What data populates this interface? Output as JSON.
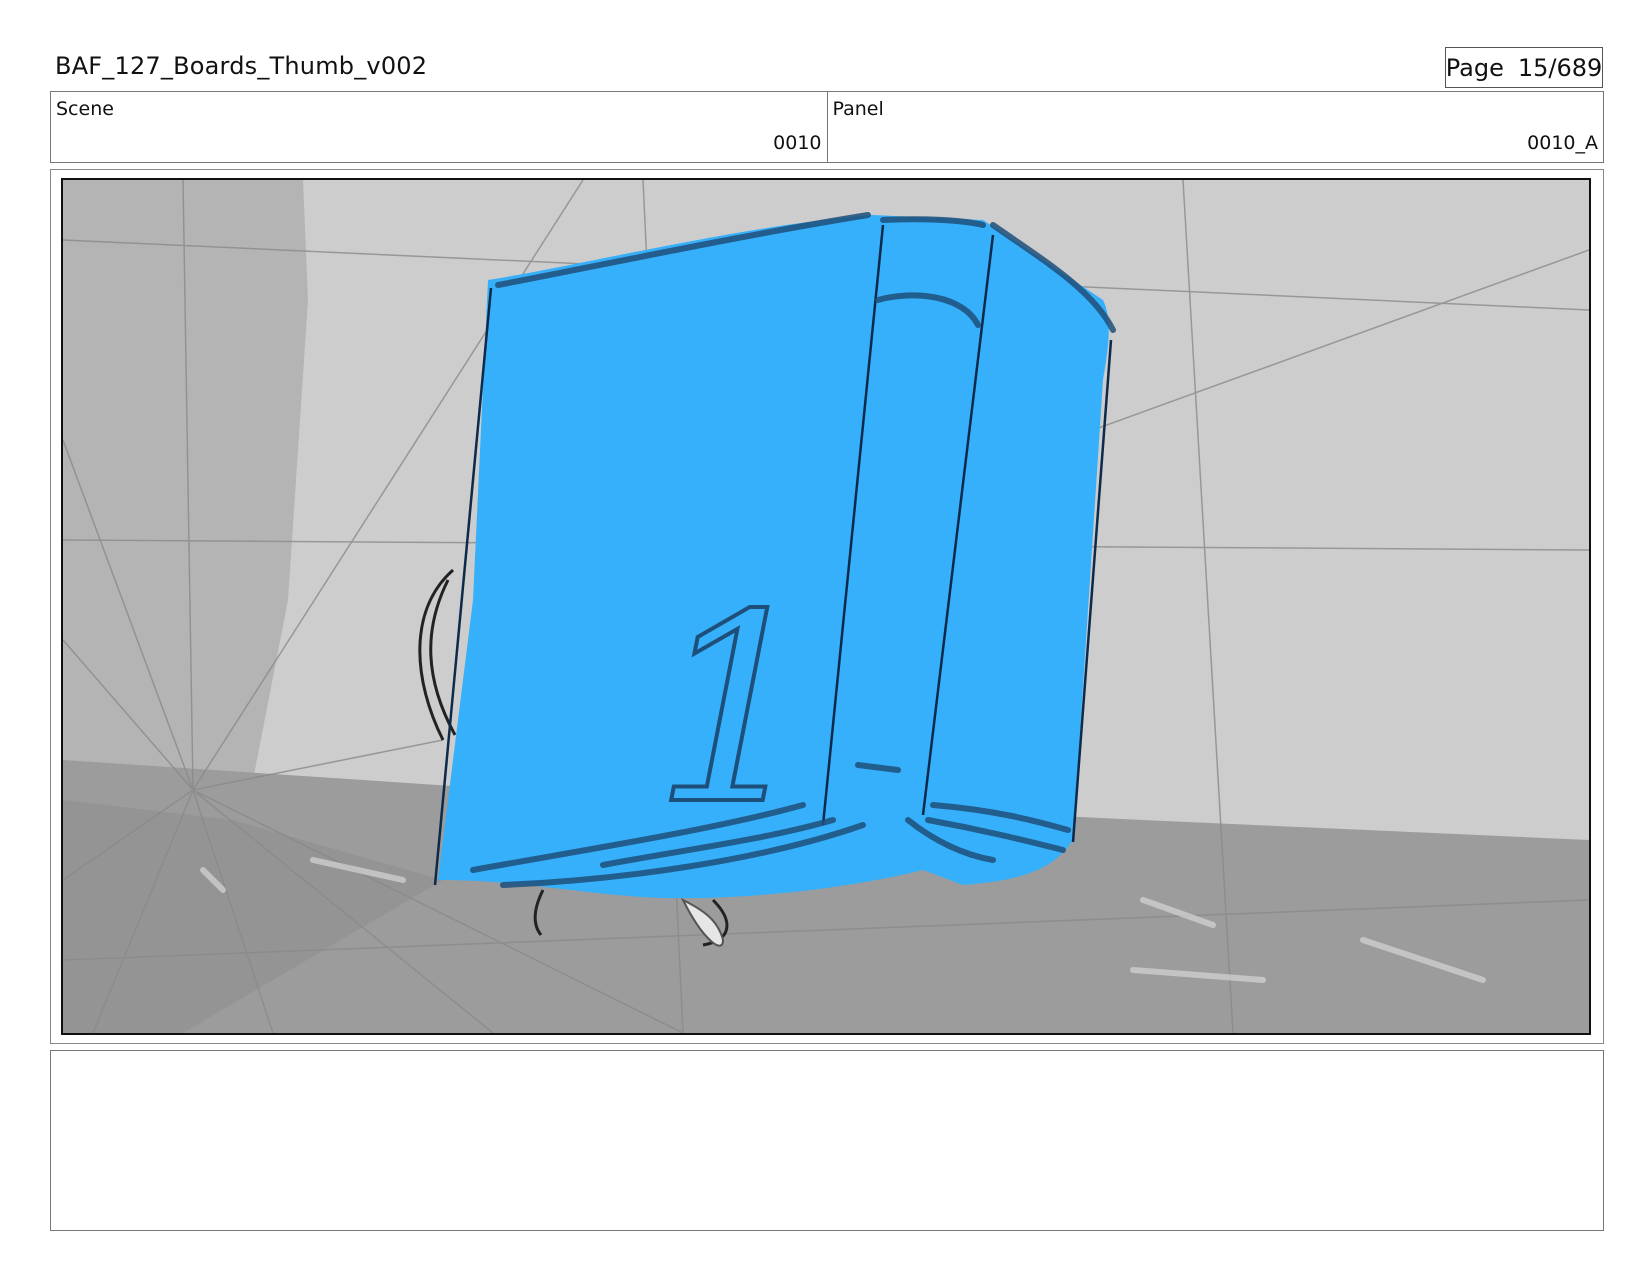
{
  "header": {
    "title": "BAF_127_Boards_Thumb_v002",
    "page_label": "Page",
    "page_value": "15/689"
  },
  "info": {
    "scene_label": "Scene",
    "scene_value": "0010",
    "panel_label": "Panel",
    "panel_value": "0010_A"
  },
  "artwork": {
    "book_color": "#36b0fb",
    "book_number": "1"
  },
  "notes": {
    "text": ""
  }
}
